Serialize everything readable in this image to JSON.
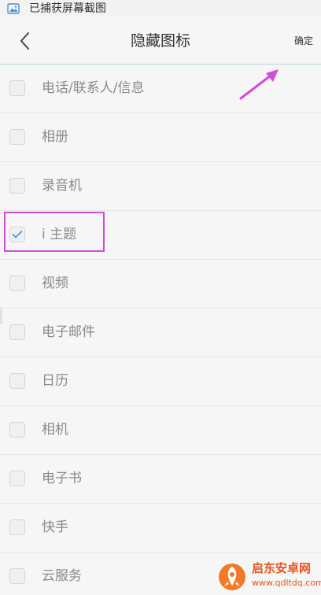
{
  "status_bar": {
    "icon": "screenshot-gallery-icon",
    "text": "已捕获屏幕截图"
  },
  "header": {
    "back_icon": "chevron-left-icon",
    "title": "隐藏图标",
    "confirm_label": "确定"
  },
  "items": [
    {
      "label": "电话/联系人/信息",
      "checked": false
    },
    {
      "label": "相册",
      "checked": false
    },
    {
      "label": "录音机",
      "checked": false
    },
    {
      "label": "i 主题",
      "checked": true
    },
    {
      "label": "视频",
      "checked": false
    },
    {
      "label": "电子邮件",
      "checked": false
    },
    {
      "label": "日历",
      "checked": false
    },
    {
      "label": "相机",
      "checked": false
    },
    {
      "label": "电子书",
      "checked": false
    },
    {
      "label": "快手",
      "checked": false
    },
    {
      "label": "云服务",
      "checked": false
    }
  ],
  "watermark": {
    "title": "启东安卓网",
    "url": "www.qdltdq.com"
  },
  "colors": {
    "annotation": "#d24bd8",
    "check": "#3a9be0",
    "watermark": "#e8541c"
  }
}
